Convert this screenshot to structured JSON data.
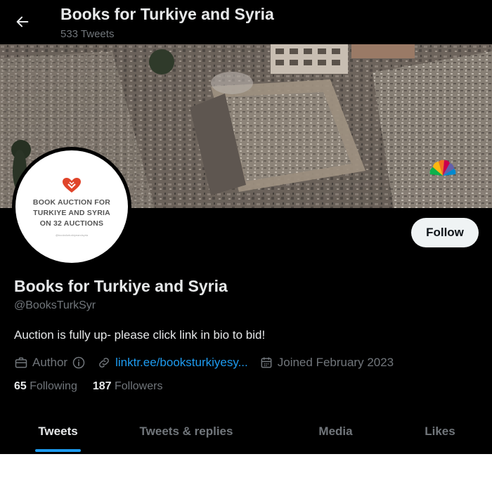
{
  "header": {
    "title": "Books for Turkiye and Syria",
    "tweet_count": "533 Tweets",
    "back_icon": "arrow-left-icon"
  },
  "avatar": {
    "line1": "BOOK AUCTION FOR",
    "line2": "TURKIYE AND SYRIA",
    "line3": "ON 32 AUCTIONS",
    "small_text": "@booksforturkiyeandsyria"
  },
  "follow_label": "Follow",
  "profile": {
    "name": "Books for Turkiye and Syria",
    "handle": "@BooksTurkSyr",
    "bio": "Auction is fully up- please click link in bio to bid!",
    "category": "Author",
    "link": "linktr.ee/bookstur​kiyesy...",
    "joined": "Joined February 2023"
  },
  "stats": {
    "following_count": "65",
    "following_label": "Following",
    "followers_count": "187",
    "followers_label": "Followers"
  },
  "tabs": [
    {
      "label": "Tweets",
      "active": true
    },
    {
      "label": "Tweets & replies",
      "active": false
    },
    {
      "label": "Media",
      "active": false
    },
    {
      "label": "Likes",
      "active": false
    }
  ],
  "colors": {
    "background": "#000000",
    "accent": "#1d9bf0",
    "primary_text": "#e7e9ea",
    "secondary_text": "#71767b",
    "logo_red": "#e0442a"
  }
}
